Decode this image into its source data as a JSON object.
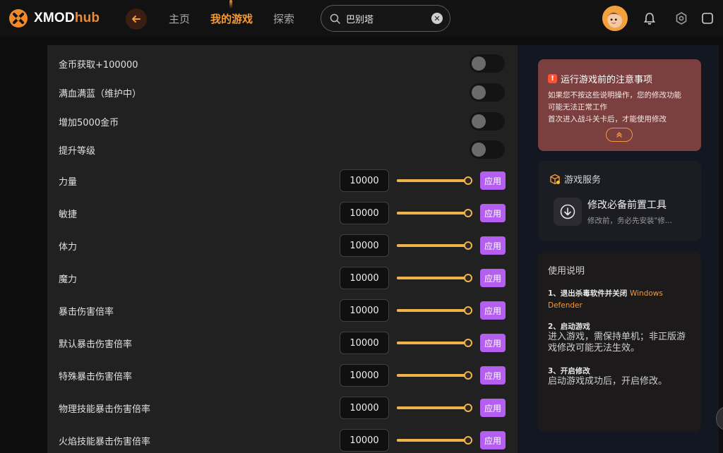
{
  "app": {
    "logo_main": "XMOD",
    "logo_accent": "hub"
  },
  "nav": {
    "home": "主页",
    "my_games": "我的游戏",
    "explore": "探索"
  },
  "search": {
    "value": "巴别塔"
  },
  "toggles": [
    {
      "label": "金币获取+100000",
      "on": false
    },
    {
      "label": "满血满蓝（维护中）",
      "on": false
    },
    {
      "label": "增加5000金币",
      "on": false
    },
    {
      "label": "提升等级",
      "on": false
    }
  ],
  "sliders": [
    {
      "label": "力量",
      "value": "10000",
      "level_pct": 100
    },
    {
      "label": "敏捷",
      "value": "10000",
      "level_pct": 100
    },
    {
      "label": "体力",
      "value": "10000",
      "level_pct": 100
    },
    {
      "label": "魔力",
      "value": "10000",
      "level_pct": 100
    },
    {
      "label": "暴击伤害倍率",
      "value": "10000",
      "level_pct": 100
    },
    {
      "label": "默认暴击伤害倍率",
      "value": "10000",
      "level_pct": 100
    },
    {
      "label": "特殊暴击伤害倍率",
      "value": "10000",
      "level_pct": 100
    },
    {
      "label": "物理技能暴击伤害倍率",
      "value": "10000",
      "level_pct": 100
    },
    {
      "label": "火焰技能暴击伤害倍率",
      "value": "10000",
      "level_pct": 100
    }
  ],
  "apply_label": "应用",
  "notice": {
    "title": "运行游戏前的注意事项",
    "line1": "如果您不按这些说明操作，您的修改功能",
    "line2": "可能无法正常工作",
    "line3": "首次进入战斗关卡后，才能使用修改"
  },
  "service": {
    "header": "游戏服务",
    "title": "修改必备前置工具",
    "subtitle": "修改前，务必先安装\"修..."
  },
  "usage": {
    "title": "使用说明",
    "step1_head": "1、退出杀毒软件并关闭",
    "step1_link_a": "Windows",
    "step1_link_b": "Defender",
    "step2_head": "2、启动游戏",
    "step2_body_a": "进入游戏，需保持单机；非正版游",
    "step2_body_b": "戏修改可能无法生效。",
    "step3_head": "3、开启修改",
    "step3_body": "启动游戏成功后，开启修改。"
  },
  "colors": {
    "accent": "#f39a3a",
    "apply": "#b45ff0",
    "slider": "#f0b24a",
    "notice_bg": "#7a3f3e"
  }
}
